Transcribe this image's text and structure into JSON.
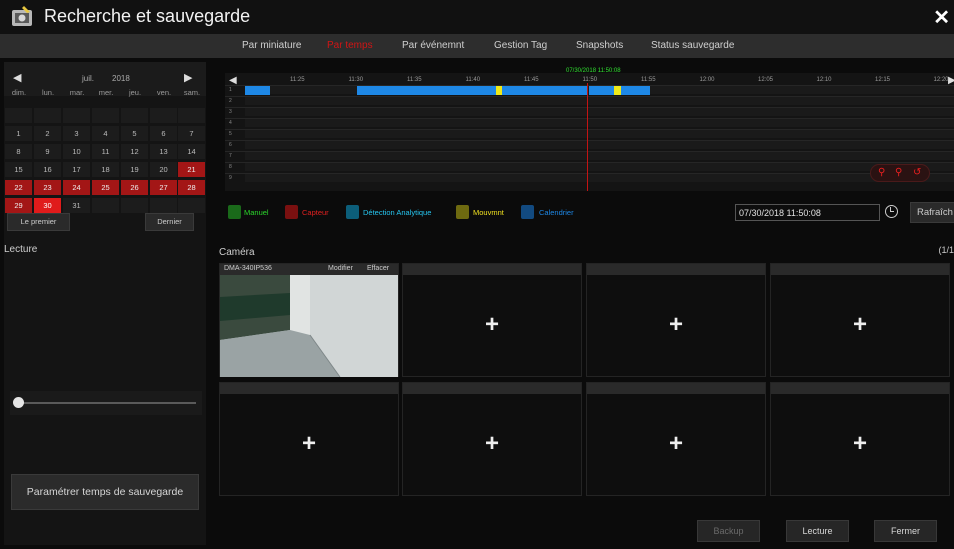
{
  "window": {
    "title": "Recherche et sauvegarde"
  },
  "tabs": [
    {
      "label": "Par miniature"
    },
    {
      "label": "Par temps"
    },
    {
      "label": "Par événemnt"
    },
    {
      "label": "Gestion Tag"
    },
    {
      "label": "Snapshots"
    },
    {
      "label": "Status sauvegarde"
    }
  ],
  "active_tab": 1,
  "calendar": {
    "month": "juil.",
    "year": "2018",
    "weekdays": [
      "dim.",
      "lun.",
      "mar.",
      "mer.",
      "jeu.",
      "ven.",
      "sam."
    ],
    "weeks": [
      [
        "",
        "",
        "",
        "",
        "",
        "",
        ""
      ],
      [
        "1",
        "2",
        "3",
        "4",
        "5",
        "6",
        "7"
      ],
      [
        "8",
        "9",
        "10",
        "11",
        "12",
        "13",
        "14"
      ],
      [
        "15",
        "16",
        "17",
        "18",
        "19",
        "20",
        "21"
      ],
      [
        "22",
        "23",
        "24",
        "25",
        "26",
        "27",
        "28"
      ],
      [
        "29",
        "30",
        "31",
        "",
        "",
        "",
        ""
      ]
    ],
    "days_with_recordings": [
      "21",
      "22",
      "23",
      "24",
      "25",
      "26",
      "27",
      "28",
      "29",
      "30"
    ],
    "selected_day": "30",
    "first_label": "Le premier",
    "last_label": "Dernier"
  },
  "playback": {
    "label": "Lecture",
    "position": 0
  },
  "param_button": "Paramétrer temps de sauvegarde",
  "timeline": {
    "current_time": "07/30/2018 11:50:08",
    "ticks": [
      "11:25",
      "11:30",
      "11:35",
      "11:40",
      "11:45",
      "11:50",
      "11:55",
      "12:00",
      "12:05",
      "12:10",
      "12:15",
      "12:20"
    ],
    "channels": [
      "1",
      "2",
      "3",
      "4",
      "5",
      "6",
      "7",
      "8",
      "9"
    ]
  },
  "legend": [
    {
      "label": "Manuel",
      "color": "#2bd62b",
      "icon": "hand-icon"
    },
    {
      "label": "Capteur",
      "color": "#e02020",
      "icon": "sensor-icon"
    },
    {
      "label": "Détection Analytique",
      "color": "#26c6f0",
      "icon": "analytics-icon"
    },
    {
      "label": "Mouvmnt",
      "color": "#f0e020",
      "icon": "motion-icon"
    },
    {
      "label": "Calendrier",
      "color": "#1e88e6",
      "icon": "calendar-icon"
    }
  ],
  "datetime_value": "07/30/2018 11:50:08",
  "refresh_label": "Rafraîch",
  "camera": {
    "label": "Caméra",
    "page": "(1/1",
    "name": "DMA-340IP536",
    "modify": "Modifier",
    "delete": "Effacer",
    "add_symbol": "+"
  },
  "buttons": {
    "backup": "Backup",
    "playback": "Lecture",
    "close": "Fermer"
  },
  "colors": {
    "accent": "#e01b1b",
    "schedule": "#1e88e6",
    "motion": "#eeea1a"
  }
}
